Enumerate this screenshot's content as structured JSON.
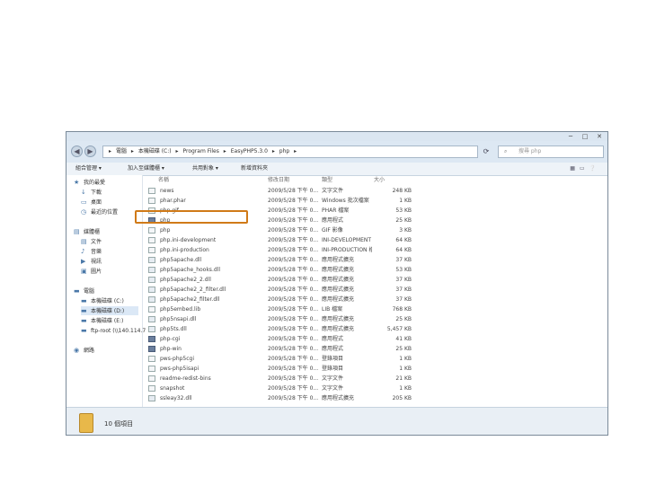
{
  "window": {
    "controls": [
      "─",
      "□",
      "✕"
    ],
    "address": {
      "segments": [
        "電腦",
        "本機磁碟 (C:)",
        "Program Files",
        "EasyPHP5.3.0",
        "php"
      ],
      "separator": "▸"
    },
    "search": {
      "placeholder": "搜尋 php"
    },
    "toolbar": {
      "items": [
        "組合管理 ▾",
        "加入至媒體櫃 ▾",
        "共用對象 ▾",
        "新增資料夾"
      ]
    },
    "nav": {
      "items": [
        {
          "label": "我的最愛",
          "icon": "★"
        },
        {
          "label": "下載",
          "icon": "↓"
        },
        {
          "label": "桌面",
          "icon": "▭"
        },
        {
          "label": "最近的位置",
          "icon": "◷"
        },
        {
          "label": "媒體櫃",
          "icon": "▤"
        },
        {
          "label": "文件",
          "icon": "▤"
        },
        {
          "label": "音樂",
          "icon": "♪"
        },
        {
          "label": "視訊",
          "icon": "▶"
        },
        {
          "label": "圖片",
          "icon": "▣"
        },
        {
          "label": "電腦",
          "icon": "▬"
        },
        {
          "label": "本機磁碟 (C:)",
          "icon": "▬"
        },
        {
          "label": "本機磁碟 (D:)",
          "icon": "▬"
        },
        {
          "label": "本機磁碟 (E:)",
          "icon": "▬"
        },
        {
          "label": "ftp-root (\\\\140.114.7",
          "icon": "▬"
        },
        {
          "label": "網路",
          "icon": "◉"
        }
      ]
    },
    "columns": {
      "name": "名稱",
      "modified": "修改日期",
      "type": "類型",
      "size": "大小"
    },
    "files": [
      {
        "name": "news",
        "modified": "2009/5/28 下午 0...",
        "type": "文字文件",
        "size": "248 KB",
        "icon": "file"
      },
      {
        "name": "phar.phar",
        "modified": "2009/5/28 下午 0...",
        "type": "Windows 批次檔案",
        "size": "1 KB",
        "icon": "file"
      },
      {
        "name": "php.gif",
        "modified": "2009/5/28 下午 0...",
        "type": "PHAR 檔案",
        "size": "53 KB",
        "icon": "file"
      },
      {
        "name": "php",
        "modified": "2009/5/28 下午 0...",
        "type": "應用程式",
        "size": "25 KB",
        "icon": "exe"
      },
      {
        "name": "php",
        "modified": "2009/5/28 下午 0...",
        "type": "GIF 影像",
        "size": "3 KB",
        "icon": "file"
      },
      {
        "name": "php.ini-development",
        "modified": "2009/5/28 下午 0...",
        "type": "INI-DEVELOPMENT ...",
        "size": "64 KB",
        "icon": "file"
      },
      {
        "name": "php.ini-production",
        "modified": "2009/5/28 下午 0...",
        "type": "INI-PRODUCTION 檔...",
        "size": "64 KB",
        "icon": "file"
      },
      {
        "name": "php5apache.dll",
        "modified": "2009/5/28 下午 0...",
        "type": "應用程式擴充",
        "size": "37 KB",
        "icon": "dll"
      },
      {
        "name": "php5apache_hooks.dll",
        "modified": "2009/5/28 下午 0...",
        "type": "應用程式擴充",
        "size": "53 KB",
        "icon": "dll"
      },
      {
        "name": "php5apache2_2.dll",
        "modified": "2009/5/28 下午 0...",
        "type": "應用程式擴充",
        "size": "37 KB",
        "icon": "dll"
      },
      {
        "name": "php5apache2_2_filter.dll",
        "modified": "2009/5/28 下午 0...",
        "type": "應用程式擴充",
        "size": "37 KB",
        "icon": "dll"
      },
      {
        "name": "php5apache2_filter.dll",
        "modified": "2009/5/28 下午 0...",
        "type": "應用程式擴充",
        "size": "37 KB",
        "icon": "dll"
      },
      {
        "name": "php5embed.lib",
        "modified": "2009/5/28 下午 0...",
        "type": "LIB 檔案",
        "size": "768 KB",
        "icon": "file"
      },
      {
        "name": "php5nsapi.dll",
        "modified": "2009/5/28 下午 0...",
        "type": "應用程式擴充",
        "size": "25 KB",
        "icon": "dll"
      },
      {
        "name": "php5ts.dll",
        "modified": "2009/5/28 下午 0...",
        "type": "應用程式擴充",
        "size": "5,457 KB",
        "icon": "dll"
      },
      {
        "name": "php-cgi",
        "modified": "2009/5/28 下午 0...",
        "type": "應用程式",
        "size": "41 KB",
        "icon": "exe"
      },
      {
        "name": "php-win",
        "modified": "2009/5/28 下午 0...",
        "type": "應用程式",
        "size": "25 KB",
        "icon": "exe"
      },
      {
        "name": "pws-php5cgi",
        "modified": "2009/5/28 下午 0...",
        "type": "登錄項目",
        "size": "1 KB",
        "icon": "file"
      },
      {
        "name": "pws-php5isapi",
        "modified": "2009/5/28 下午 0...",
        "type": "登錄項目",
        "size": "1 KB",
        "icon": "file"
      },
      {
        "name": "readme-redist-bins",
        "modified": "2009/5/28 下午 0...",
        "type": "文字文件",
        "size": "21 KB",
        "icon": "file"
      },
      {
        "name": "snapshot",
        "modified": "2009/5/28 下午 0...",
        "type": "文字文件",
        "size": "1 KB",
        "icon": "file"
      },
      {
        "name": "ssleay32.dll",
        "modified": "2009/5/28 下午 0...",
        "type": "應用程式擴充",
        "size": "205 KB",
        "icon": "dll"
      }
    ],
    "status": {
      "count": "10 個項目"
    }
  }
}
